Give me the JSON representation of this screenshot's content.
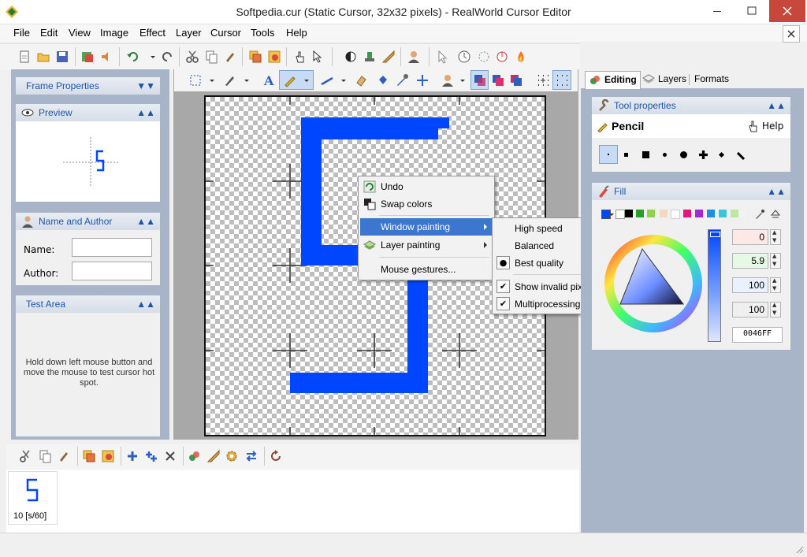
{
  "window": {
    "title": "Softpedia.cur (Static Cursor, 32x32 pixels) - RealWorld Cursor Editor"
  },
  "menu": [
    "File",
    "Edit",
    "View",
    "Image",
    "Effect",
    "Layer",
    "Cursor",
    "Tools",
    "Help"
  ],
  "left": {
    "frame_properties": "Frame Properties",
    "preview": "Preview",
    "name_author": "Name and Author",
    "name_label": "Name:",
    "author_label": "Author:",
    "test_area": "Test Area",
    "test_hint": "Hold down left mouse button and move the mouse to test cursor hot spot."
  },
  "context_menu": {
    "items": [
      "Undo",
      "Swap colors",
      "Window painting",
      "Layer painting",
      "Mouse gestures..."
    ]
  },
  "submenu": {
    "items": [
      "High speed",
      "Balanced",
      "Best quality",
      "Show invalid pixels",
      "Multiprocessing"
    ]
  },
  "right": {
    "tabs": [
      "Editing",
      "Layers",
      "Formats"
    ],
    "tool_properties": "Tool properties",
    "tool_name": "Pencil",
    "help": "Help",
    "fill": "Fill",
    "values": [
      "0",
      "5.9",
      "100",
      "100"
    ],
    "hex": "0046FF"
  },
  "palette": [
    "#0046ff",
    "#ffffff",
    "#000000",
    "#27a027",
    "#8fd34b",
    "#f3d9c0",
    "#ffffff",
    "#e5147c",
    "#a12ad0",
    "#1b8ee6",
    "#38c6d4",
    "#bde5a3",
    "#f2f2f2"
  ],
  "frames": {
    "label": "10 [s/60]"
  }
}
